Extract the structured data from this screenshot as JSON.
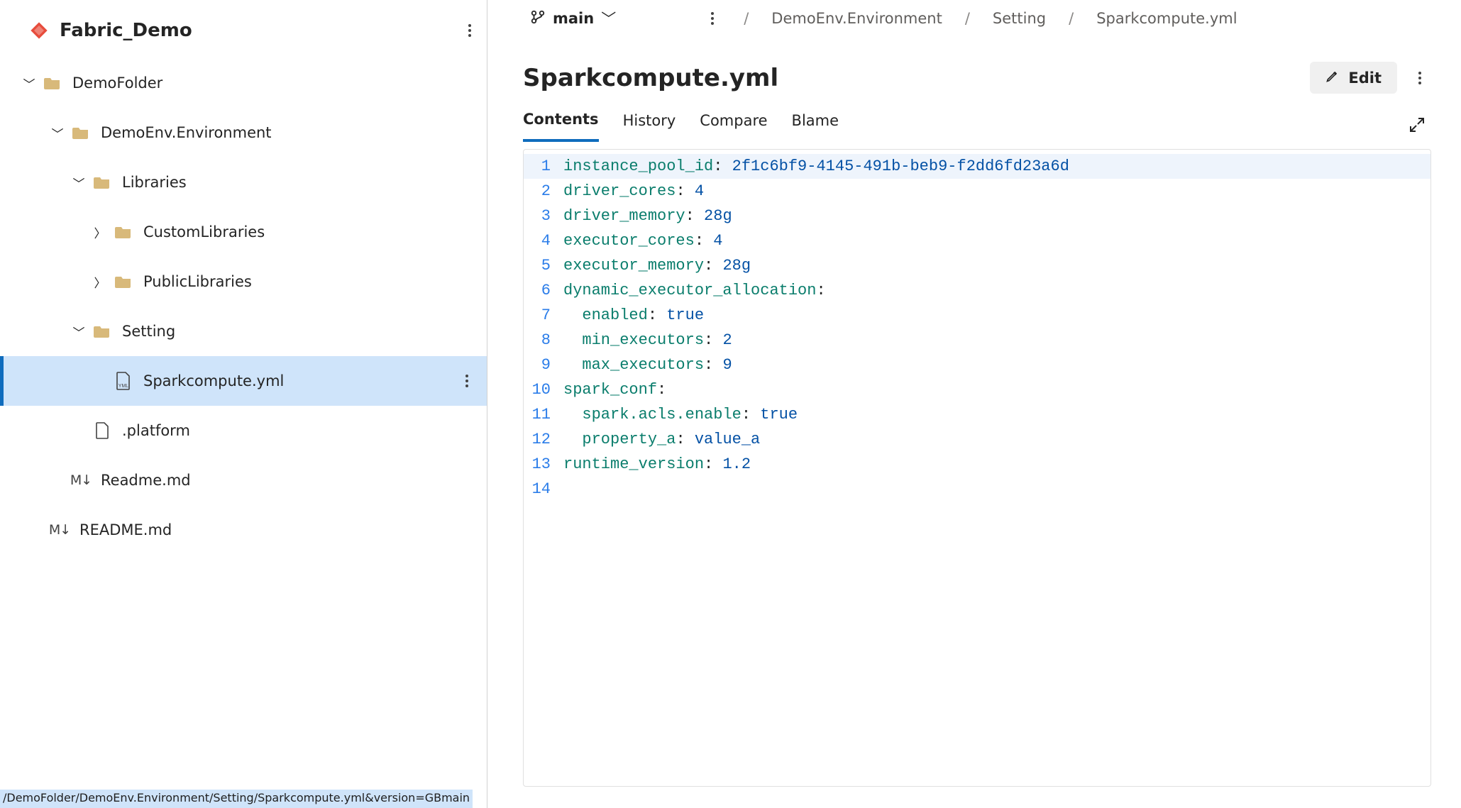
{
  "repo": {
    "name": "Fabric_Demo"
  },
  "tree": {
    "demoFolder": "DemoFolder",
    "demoEnv": "DemoEnv.Environment",
    "libraries": "Libraries",
    "customLib": "CustomLibraries",
    "publicLib": "PublicLibraries",
    "setting": "Setting",
    "sparkcompute": "Sparkcompute.yml",
    "platform": ".platform",
    "readme1": "Readme.md",
    "readme2": "README.md"
  },
  "branch": {
    "name": "main"
  },
  "breadcrumbs": {
    "a": "DemoEnv.Environment",
    "b": "Setting",
    "c": "Sparkcompute.yml"
  },
  "file": {
    "title": "Sparkcompute.yml"
  },
  "buttons": {
    "edit": "Edit"
  },
  "tabs": {
    "contents": "Contents",
    "history": "History",
    "compare": "Compare",
    "blame": "Blame"
  },
  "code": {
    "n1": "1",
    "n2": "2",
    "n3": "3",
    "n4": "4",
    "n5": "5",
    "n6": "6",
    "n7": "7",
    "n8": "8",
    "n9": "9",
    "n10": "10",
    "n11": "11",
    "n12": "12",
    "n13": "13",
    "n14": "14",
    "l1_k": "instance_pool_id",
    "l1_c": ": ",
    "l1_v": "2f1c6bf9-4145-491b-beb9-f2dd6fd23a6d",
    "l2_k": "driver_cores",
    "l2_c": ": ",
    "l2_v": "4",
    "l3_k": "driver_memory",
    "l3_c": ": ",
    "l3_v": "28g",
    "l4_k": "executor_cores",
    "l4_c": ": ",
    "l4_v": "4",
    "l5_k": "executor_memory",
    "l5_c": ": ",
    "l5_v": "28g",
    "l6_k": "dynamic_executor_allocation",
    "l6_c": ":",
    "l7_i": "  ",
    "l7_k": "enabled",
    "l7_c": ": ",
    "l7_v": "true",
    "l8_i": "  ",
    "l8_k": "min_executors",
    "l8_c": ": ",
    "l8_v": "2",
    "l9_i": "  ",
    "l9_k": "max_executors",
    "l9_c": ": ",
    "l9_v": "9",
    "l10_k": "spark_conf",
    "l10_c": ":",
    "l11_i": "  ",
    "l11_k": "spark.acls.enable",
    "l11_c": ": ",
    "l11_v": "true",
    "l12_i": "  ",
    "l12_k": "property_a",
    "l12_c": ": ",
    "l12_v": "value_a",
    "l13_k": "runtime_version",
    "l13_c": ": ",
    "l13_v": "1.2"
  },
  "status": {
    "text": "/DemoFolder/DemoEnv.Environment/Setting/Sparkcompute.yml&version=GBmain"
  }
}
